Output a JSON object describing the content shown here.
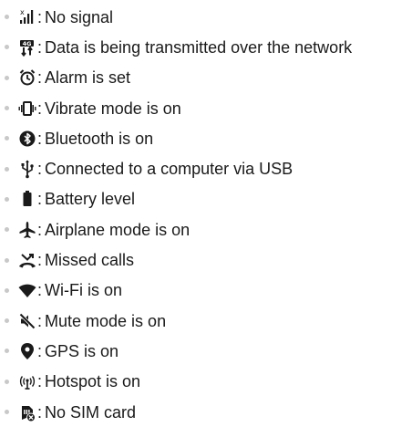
{
  "items": [
    {
      "icon": "no-signal-icon",
      "separator": ":",
      "text": "No signal"
    },
    {
      "icon": "4g-data-transfer-icon",
      "separator": ":",
      "text": "Data is being transmitted over the network",
      "icon_text": "4G"
    },
    {
      "icon": "alarm-clock-icon",
      "separator": ":",
      "text": "Alarm is set"
    },
    {
      "icon": "vibrate-icon",
      "separator": ":",
      "text": "Vibrate mode is on"
    },
    {
      "icon": "bluetooth-icon",
      "separator": ":",
      "text": "Bluetooth is on"
    },
    {
      "icon": "usb-icon",
      "separator": ":",
      "text": "Connected to a computer via USB"
    },
    {
      "icon": "battery-icon",
      "separator": ":",
      "text": "Battery level"
    },
    {
      "icon": "airplane-icon",
      "separator": ":",
      "text": "Airplane mode is on"
    },
    {
      "icon": "missed-call-icon",
      "separator": ":",
      "text": "Missed calls"
    },
    {
      "icon": "wifi-icon",
      "separator": ":",
      "text": "Wi-Fi is on"
    },
    {
      "icon": "mute-icon",
      "separator": ":",
      "text": "Mute mode is on"
    },
    {
      "icon": "gps-icon",
      "separator": ":",
      "text": "GPS is on"
    },
    {
      "icon": "hotspot-icon",
      "separator": ":",
      "text": "Hotspot is on"
    },
    {
      "icon": "no-sim-icon",
      "separator": ":",
      "text": "No SIM card"
    }
  ],
  "colors": {
    "icon": "#1a1a1a",
    "bullet": "#c8c8c8",
    "text": "#1a1a1a"
  }
}
